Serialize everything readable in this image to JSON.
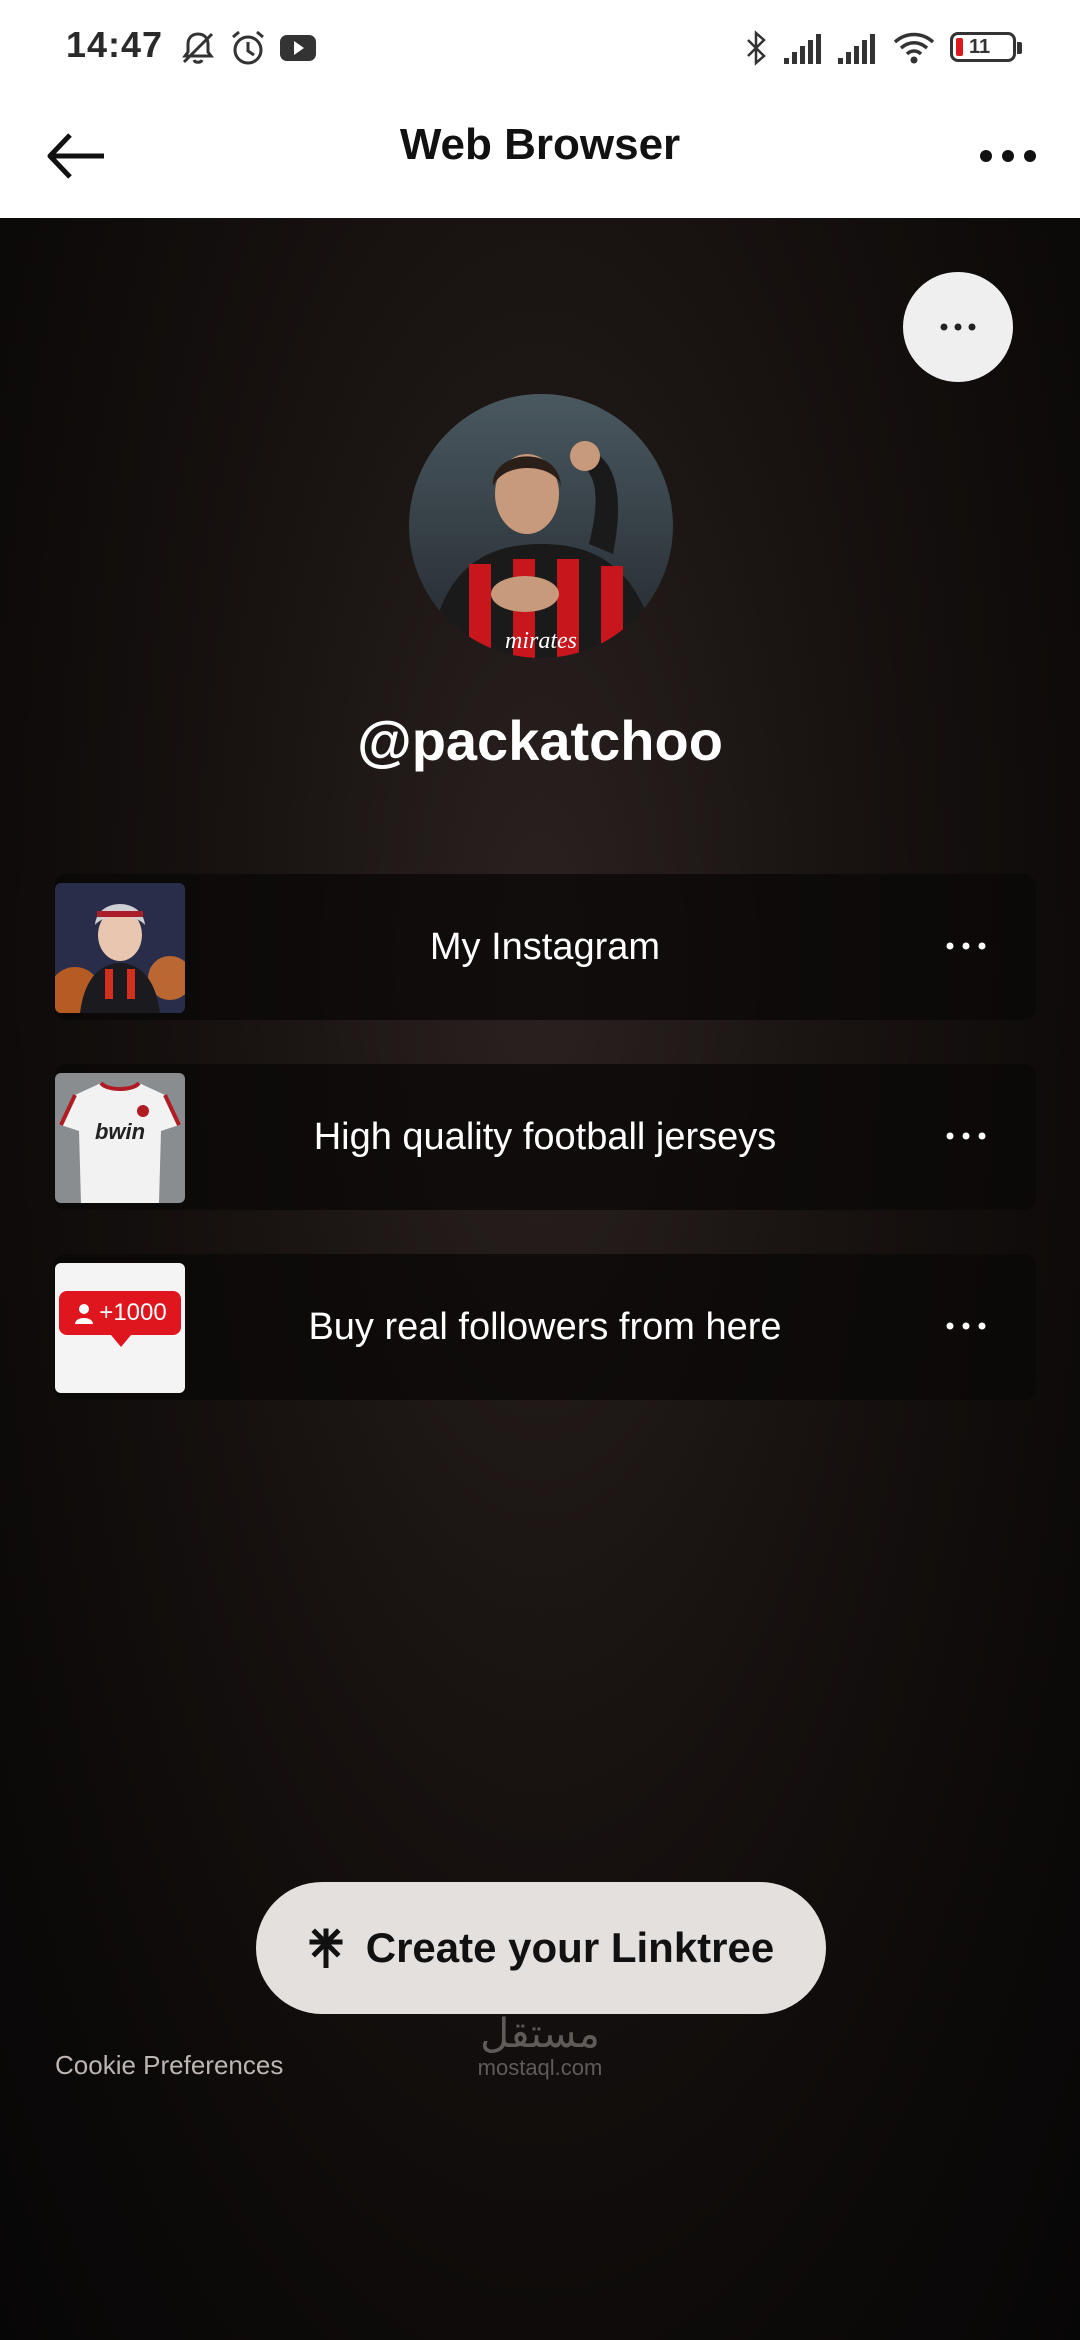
{
  "status_bar": {
    "time": "14:47",
    "battery": "11",
    "icons": [
      "bell-off-icon",
      "alarm-icon",
      "youtube-icon",
      "bluetooth-icon",
      "signal-icon",
      "signal-icon",
      "wifi-icon",
      "battery-icon"
    ]
  },
  "header": {
    "title": "Web Browser",
    "back_icon": "arrow-left-icon",
    "more_icon": "more-horizontal-icon"
  },
  "profile": {
    "username": "@packatchoo",
    "avatar": "avatar-photo"
  },
  "links": [
    {
      "label": "My Instagram",
      "thumb": "anime-character-thumb"
    },
    {
      "label": "High quality football jerseys",
      "thumb": "jersey-thumb"
    },
    {
      "label": "Buy real followers from here",
      "thumb": "followers-thumb",
      "badge": "+1000"
    }
  ],
  "footer": {
    "cta": "Create your Linktree",
    "cookie": "Cookie Preferences",
    "watermark_ar": "مستقل",
    "watermark_en": "mostaql.com"
  },
  "colors": {
    "accent_red": "#e0161f",
    "cta_bg": "#e3e0dd",
    "page_bg": "#120e0d"
  }
}
